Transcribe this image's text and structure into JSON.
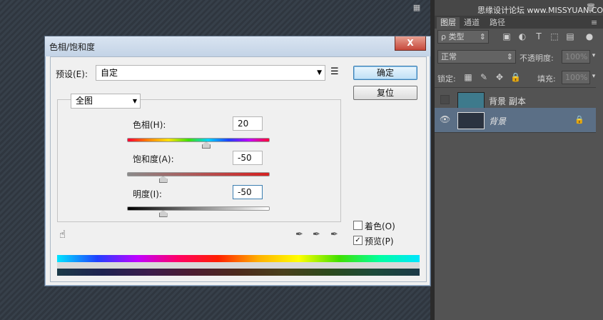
{
  "panel": {
    "watermark": "思缘设计论坛 www.MISSYUAN.COM",
    "tabs": [
      "图层",
      "通道",
      "路径"
    ],
    "kind_label": "ρ 类型",
    "blend_mode": "正常",
    "opacity_label": "不透明度:",
    "opacity_value": "100%",
    "lock_label": "锁定:",
    "fill_label": "填充:",
    "fill_value": "100%",
    "layers": [
      {
        "name": "背景 副本",
        "visible": false,
        "color": "#3e7a8c"
      },
      {
        "name": "背景",
        "visible": true,
        "color": "#2b3340"
      }
    ]
  },
  "dialog": {
    "title": "色相/饱和度",
    "close": "X",
    "preset_label": "预设(E):",
    "preset_value": "自定",
    "ok": "确定",
    "reset": "复位",
    "channel": "全图",
    "hue_label": "色相(H):",
    "hue_value": "20",
    "sat_label": "饱和度(A):",
    "sat_value": "-50",
    "light_label": "明度(I):",
    "light_value": "-50",
    "colorize": "着色(O)",
    "preview": "预览(P)",
    "colorize_checked": false,
    "preview_checked": true
  },
  "sliders": {
    "hue": {
      "min": -180,
      "max": 180,
      "value": 20
    },
    "saturation": {
      "min": -100,
      "max": 100,
      "value": -50
    },
    "lightness": {
      "min": -100,
      "max": 100,
      "value": -50
    }
  }
}
